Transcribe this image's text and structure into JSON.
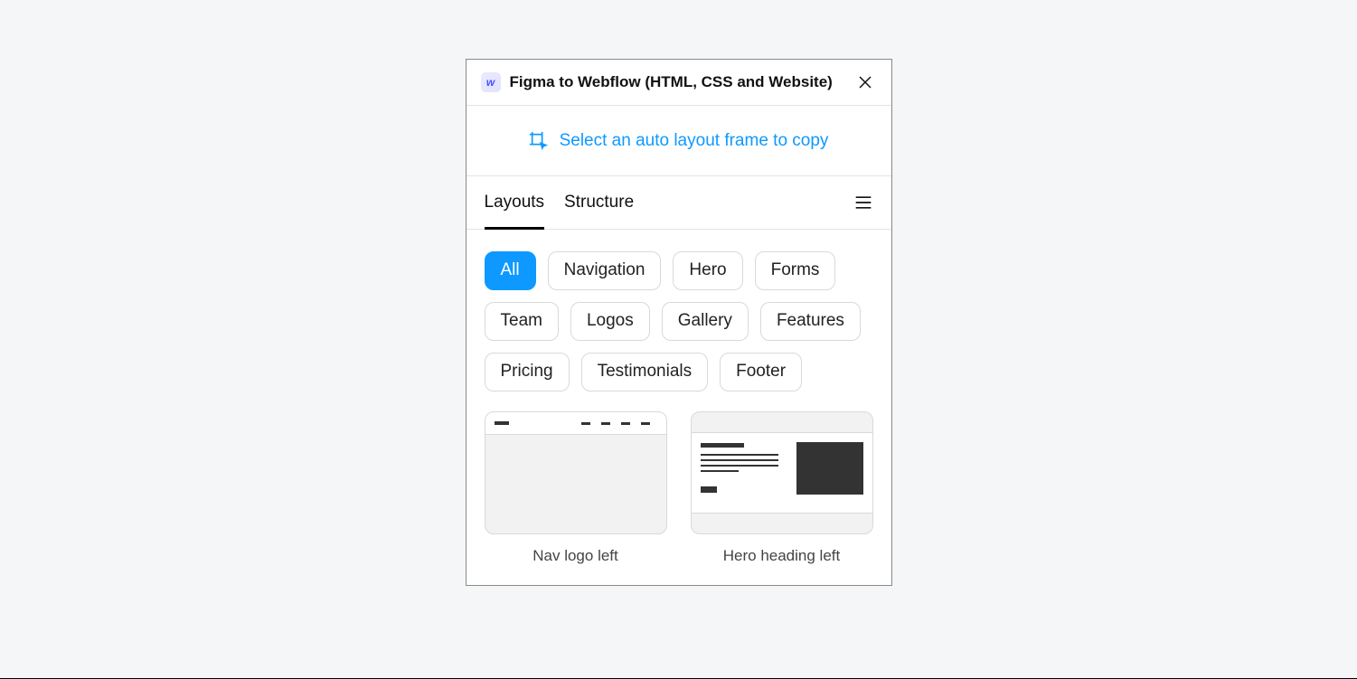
{
  "header": {
    "logo_letter": "w",
    "title": "Figma to Webflow (HTML, CSS and Website)"
  },
  "prompt": {
    "text": "Select an auto layout frame to copy"
  },
  "tabs": [
    {
      "label": "Layouts",
      "active": true
    },
    {
      "label": "Structure",
      "active": false
    }
  ],
  "filters": [
    {
      "label": "All",
      "active": true
    },
    {
      "label": "Navigation",
      "active": false
    },
    {
      "label": "Hero",
      "active": false
    },
    {
      "label": "Forms",
      "active": false
    },
    {
      "label": "Team",
      "active": false
    },
    {
      "label": "Logos",
      "active": false
    },
    {
      "label": "Gallery",
      "active": false
    },
    {
      "label": "Features",
      "active": false
    },
    {
      "label": "Pricing",
      "active": false
    },
    {
      "label": "Testimonials",
      "active": false
    },
    {
      "label": "Footer",
      "active": false
    }
  ],
  "cards": [
    {
      "label": "Nav logo left",
      "kind": "nav"
    },
    {
      "label": "Hero heading left",
      "kind": "hero"
    }
  ],
  "colors": {
    "accent": "#0d99ff"
  }
}
